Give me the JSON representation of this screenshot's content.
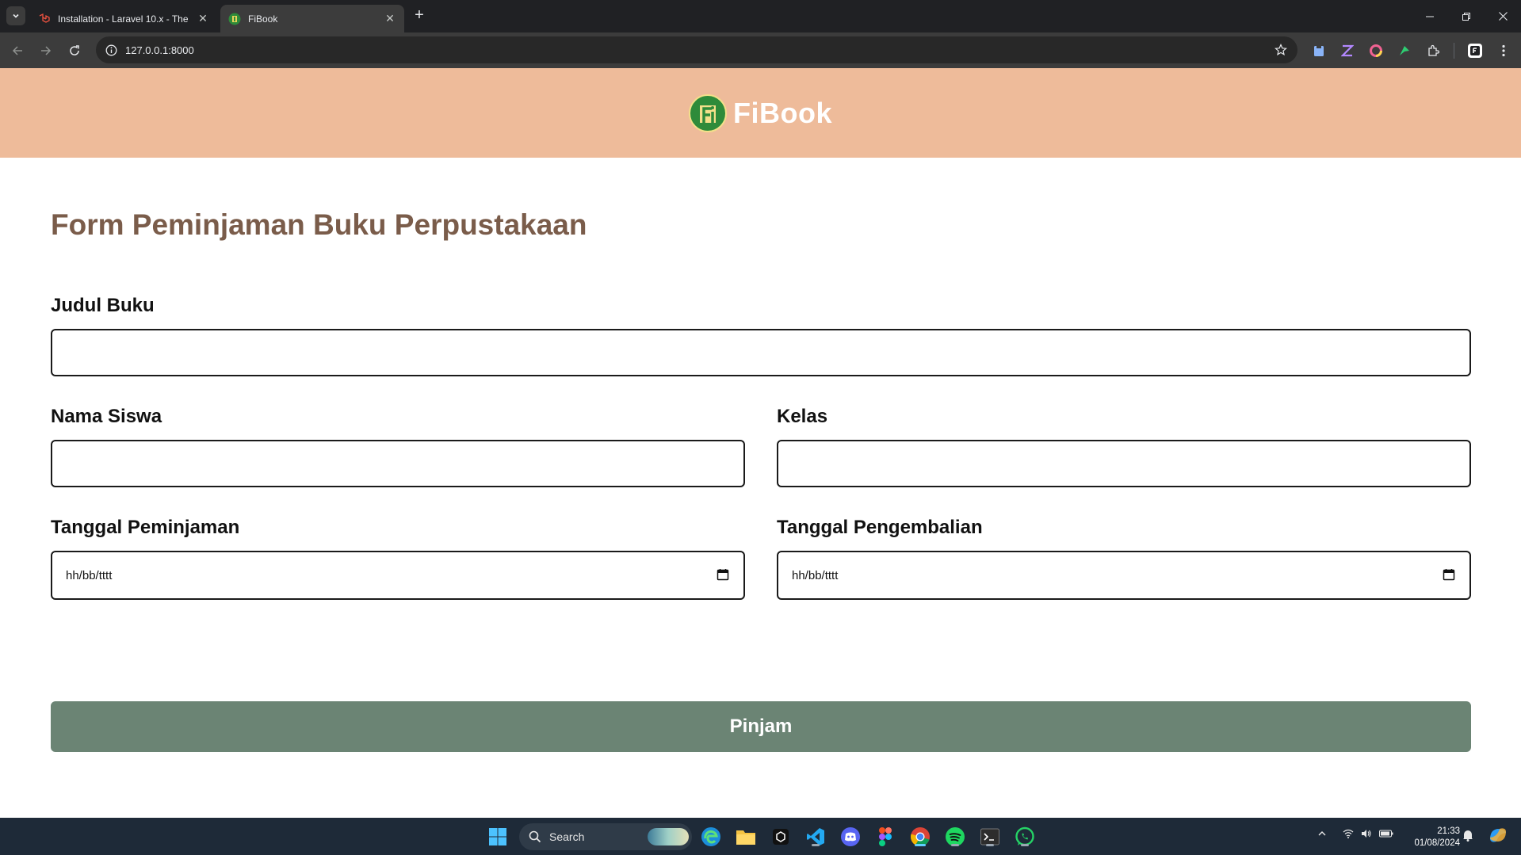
{
  "browser": {
    "tabs": [
      {
        "title": "Installation - Laravel 10.x - The",
        "active": false
      },
      {
        "title": "FiBook",
        "active": true
      }
    ],
    "url": "127.0.0.1:8000"
  },
  "header": {
    "brand": "FiBook"
  },
  "form": {
    "title": "Form Peminjaman Buku Perpustakaan",
    "judul_buku_label": "Judul Buku",
    "nama_siswa_label": "Nama Siswa",
    "kelas_label": "Kelas",
    "tanggal_peminjaman_label": "Tanggal Peminjaman",
    "tanggal_pengembalian_label": "Tanggal Pengembalian",
    "date_placeholder": "hh/bb/tttt",
    "submit_label": "Pinjam"
  },
  "taskbar": {
    "search_label": "Search",
    "time": "21:33",
    "date": "01/08/2024"
  },
  "colors": {
    "header_bg": "#eebb9a",
    "title_color": "#7a5c4a",
    "button_bg": "#6b8474"
  }
}
